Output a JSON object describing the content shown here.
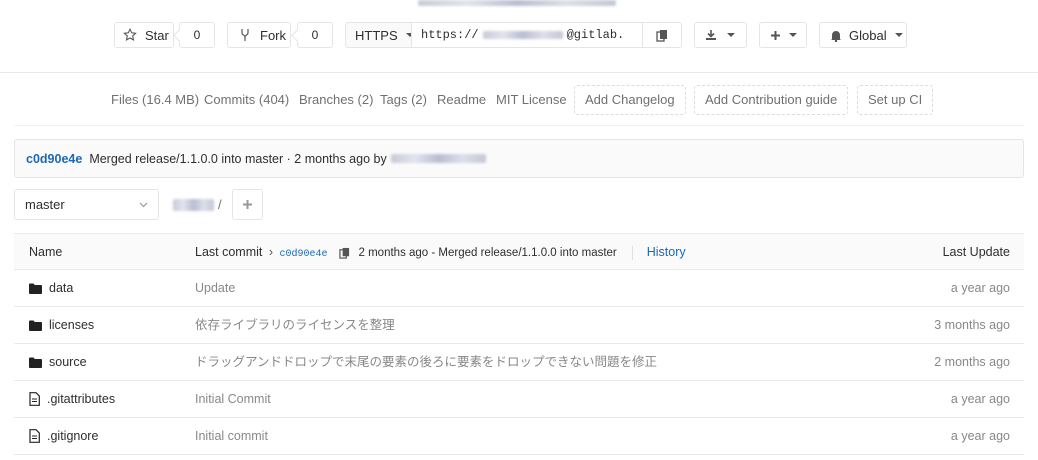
{
  "project_actions": {
    "star_label": "Star",
    "star_count": "0",
    "fork_label": "Fork",
    "fork_count": "0",
    "protocol": "HTTPS",
    "clone_url_prefix": "https://",
    "clone_url_suffix": "@gitlab.",
    "notification_label": "Global"
  },
  "stats_nav": {
    "files": "Files (16.4 MB)",
    "commits": "Commits (404)",
    "branches": "Branches (2)",
    "tags": "Tags (2)",
    "readme": "Readme",
    "license": "MIT License",
    "add_changelog": "Add Changelog",
    "add_contribution": "Add Contribution guide",
    "setup_ci": "Set up CI"
  },
  "last_commit": {
    "sha": "c0d90e4e",
    "message": "Merged release/1.1.0.0 into master · 2 months ago by"
  },
  "branch_select": {
    "value": "master"
  },
  "breadcrumb": {
    "separator": "/"
  },
  "table": {
    "header": {
      "name": "Name",
      "last_commit_label": "Last commit",
      "commit_sha": "c0d90e4e",
      "commit_info": "2 months ago - Merged release/1.1.0.0 into master",
      "history": "History",
      "last_update": "Last Update"
    },
    "rows": [
      {
        "name": "data",
        "type": "folder",
        "message": "Update",
        "updated": "a year ago"
      },
      {
        "name": "licenses",
        "type": "folder",
        "message": "依存ライブラリのライセンスを整理",
        "updated": "3 months ago"
      },
      {
        "name": "source",
        "type": "folder",
        "message": "ドラッグアンドドロップで末尾の要素の後ろに要素をドロップできない問題を修正",
        "updated": "2 months ago"
      },
      {
        "name": ".gitattributes",
        "type": "file",
        "message": "Initial Commit",
        "updated": "a year ago"
      },
      {
        "name": ".gitignore",
        "type": "file",
        "message": "Initial commit",
        "updated": "a year ago"
      }
    ]
  },
  "colors": {
    "link": "#1b69b6",
    "muted": "#707070",
    "border": "#e5e5e5"
  }
}
